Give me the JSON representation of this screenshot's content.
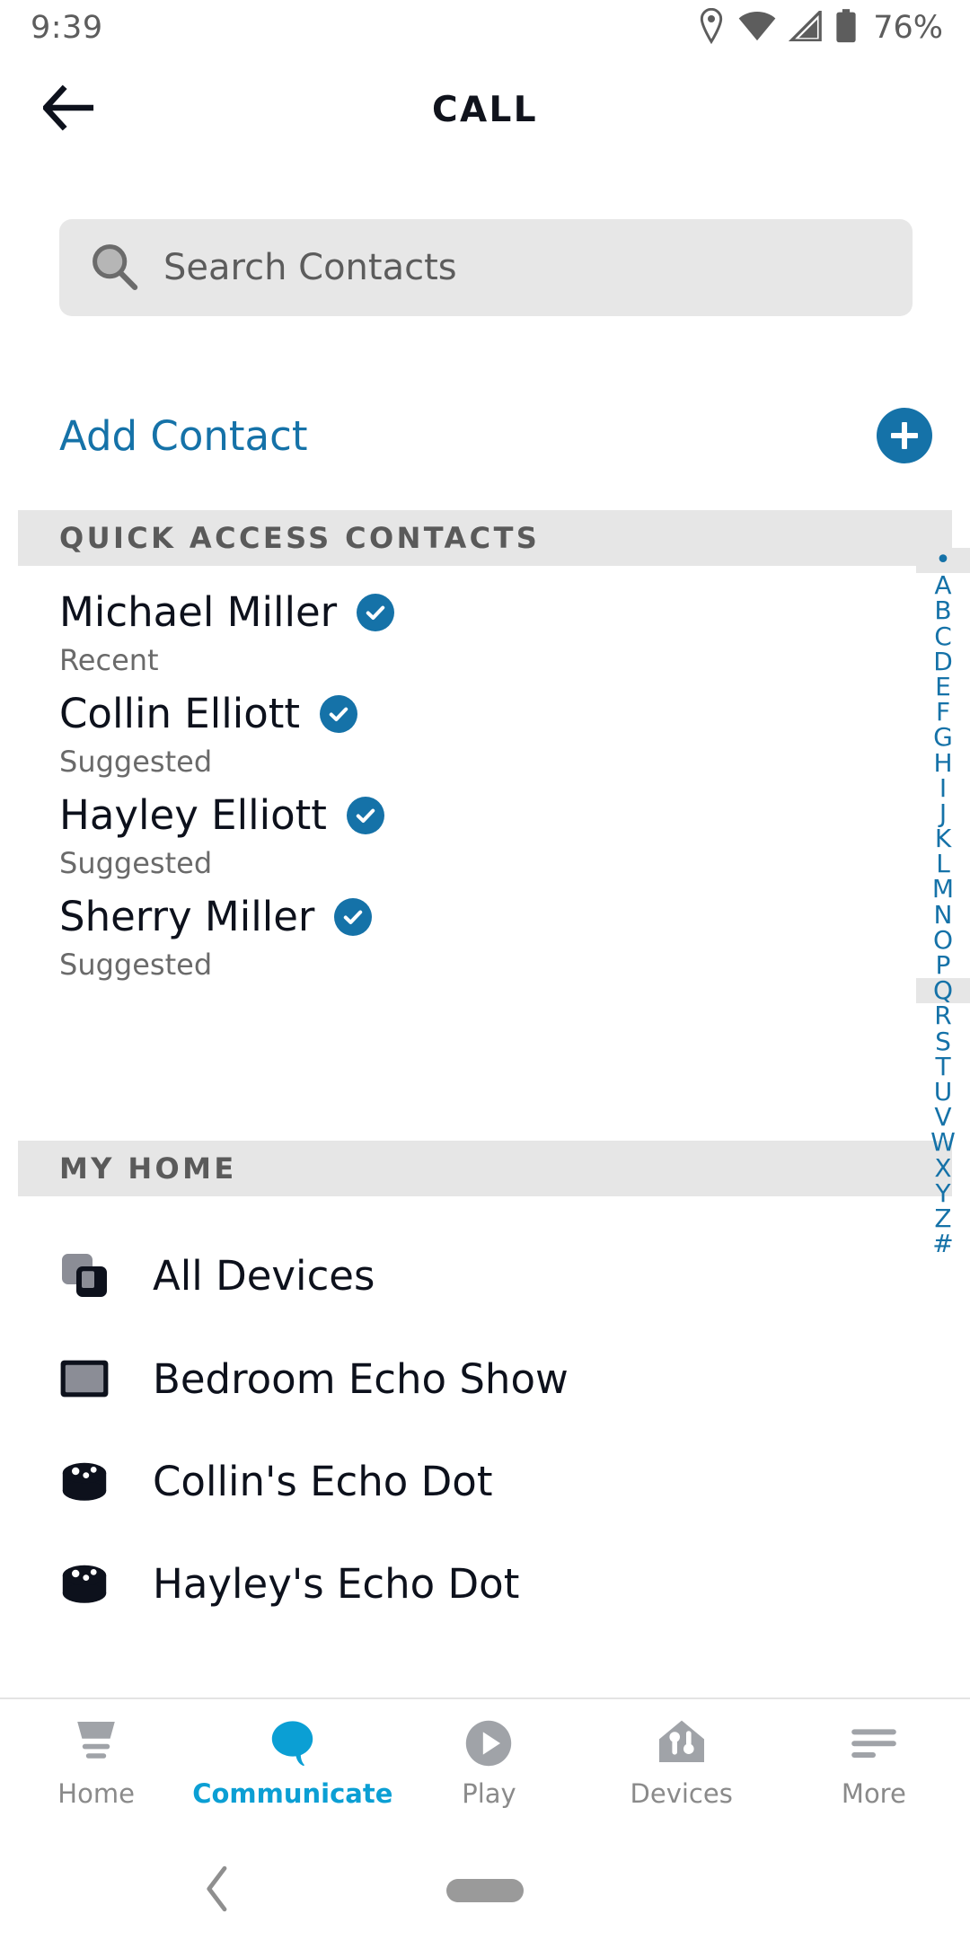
{
  "status_bar": {
    "time": "9:39",
    "battery_percent": "76%",
    "icons": [
      "location-pin-icon",
      "wifi-icon",
      "cellular-signal-icon",
      "battery-icon"
    ]
  },
  "app_bar": {
    "title": "CALL",
    "back_icon": "arrow-left-icon"
  },
  "search": {
    "placeholder": "Search Contacts",
    "icon": "search-icon"
  },
  "add_contact": {
    "label": "Add Contact",
    "button_icon": "plus-icon"
  },
  "sections": {
    "quick_access": {
      "header": "QUICK ACCESS CONTACTS",
      "contacts": [
        {
          "name": "Michael Miller",
          "subtitle": "Recent",
          "verified": true
        },
        {
          "name": "Collin Elliott",
          "subtitle": "Suggested",
          "verified": true
        },
        {
          "name": "Hayley Elliott",
          "subtitle": "Suggested",
          "verified": true
        },
        {
          "name": "Sherry Miller",
          "subtitle": "Suggested",
          "verified": true
        }
      ]
    },
    "my_home": {
      "header": "MY HOME",
      "devices": [
        {
          "name": "All Devices",
          "icon": "stacked-squares-icon"
        },
        {
          "name": "Bedroom Echo Show",
          "icon": "echo-show-screen-icon"
        },
        {
          "name": "Collin's Echo Dot",
          "icon": "echo-dot-puck-icon"
        },
        {
          "name": "Hayley's Echo Dot",
          "icon": "echo-dot-puck-icon"
        }
      ]
    }
  },
  "alphabet_index": {
    "items": [
      "•",
      "A",
      "B",
      "C",
      "D",
      "E",
      "F",
      "G",
      "H",
      "I",
      "J",
      "K",
      "L",
      "M",
      "N",
      "O",
      "P",
      "Q",
      "R",
      "S",
      "T",
      "U",
      "V",
      "W",
      "X",
      "Y",
      "Z",
      "#"
    ],
    "highlighted": "Q",
    "color": "#1572a8"
  },
  "bottom_tabs": [
    {
      "label": "Home",
      "icon": "lamp-home-icon",
      "active": false
    },
    {
      "label": "Communicate",
      "icon": "speech-bubble-icon",
      "active": true
    },
    {
      "label": "Play",
      "icon": "play-circle-icon",
      "active": false
    },
    {
      "label": "Devices",
      "icon": "house-sliders-icon",
      "active": false
    },
    {
      "label": "More",
      "icon": "hamburger-lines-icon",
      "active": false
    }
  ],
  "android_nav": {
    "back_icon": "chevron-left-icon",
    "home_pill": "home-pill-icon"
  },
  "colors": {
    "accent_blue": "#1572a8",
    "tab_active": "#0b9fd4",
    "section_bg": "#e6e6e6",
    "search_bg": "#e7e7e7",
    "text_primary": "#0d111c",
    "text_secondary": "#6a6a6a"
  }
}
